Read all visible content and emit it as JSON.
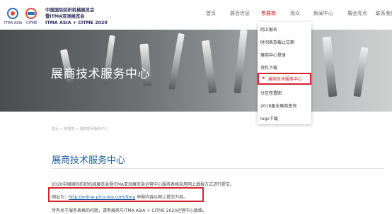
{
  "header": {
    "logo_line1": "中国国际纺织机械展览会",
    "logo_line2": "暨ITMA亚洲展览会",
    "logo_line3": "ITMA ASIA + CITME 2020",
    "logo_badge_left": "ITMA ASIA",
    "logo_badge_right": "CITME",
    "nav": [
      {
        "label": "首页"
      },
      {
        "label": "展会信息"
      },
      {
        "label": "参展商"
      },
      {
        "label": "观众"
      },
      {
        "label": "新闻中心"
      },
      {
        "label": "展会亮点"
      },
      {
        "label": "联系我们"
      }
    ],
    "active_nav": "参展商",
    "accent_color": "#c8161d"
  },
  "banner": {
    "title": "展商技术服务中心"
  },
  "breadcrumb": {
    "home": "首页",
    "sep": ">",
    "section": "参展商",
    "current": "展商技术服务中心"
  },
  "main": {
    "title": "展商技术服务中心",
    "para1": "2020中国国际纺织机械展览会暨ITMA亚洲展览会运营中心服务表格采用网上填报方式进行提交。",
    "para2_prefix": "网址为：",
    "para2_link": "http://online.pico-oos.com/itma",
    "para2_suffix": " 申报内容以网上提交为准。",
    "para3": "所有关于服务表格的问题，请参展商与ITMA ASIA + CITME 2020运营中心联络。"
  },
  "dropdown": {
    "items": [
      {
        "label": "网上报名"
      },
      {
        "label": "时间表及截止日期"
      },
      {
        "label": "展商中心登录"
      },
      {
        "label": "资料下载"
      },
      {
        "label": "展商技术服务中心"
      },
      {
        "label": "分区布置图"
      },
      {
        "label": "2018届全展商查询"
      },
      {
        "label": "logo下载"
      }
    ],
    "active_arrow": "➤"
  }
}
